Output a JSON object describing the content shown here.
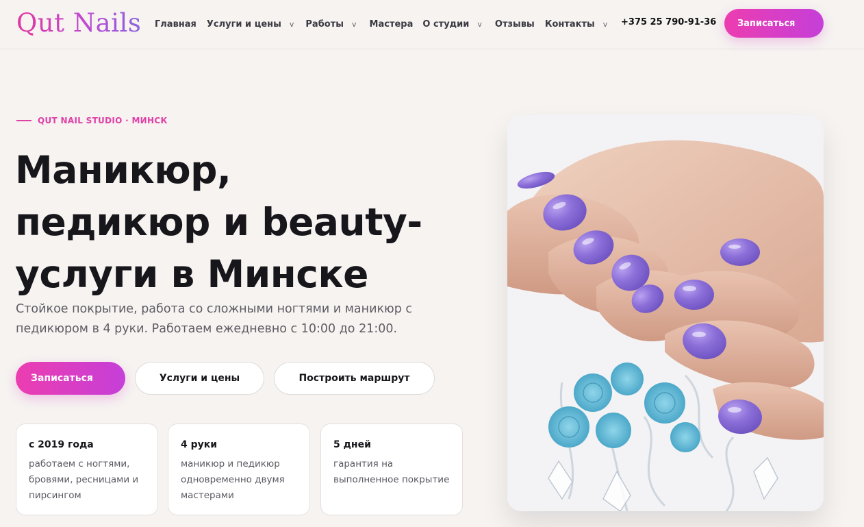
{
  "header": {
    "logo": "Qut Nails",
    "nav": [
      {
        "label": "Главная",
        "dropdown": false
      },
      {
        "label": "Услуги и цены",
        "dropdown": true
      },
      {
        "label": "Работы",
        "dropdown": true
      },
      {
        "label": "Мастера",
        "dropdown": false
      },
      {
        "label": "О студии",
        "dropdown": true
      },
      {
        "label": "Отзывы",
        "dropdown": false
      },
      {
        "label": "Контакты",
        "dropdown": true
      }
    ],
    "dropdown_glyph": "v",
    "phone": "+375 25 790-91-36",
    "cta": "Записаться"
  },
  "hero": {
    "eyebrow": "QUT NAIL STUDIO · МИНСК",
    "title_lines": [
      "Маникюр,",
      "педикюр и beauty-",
      "услуги в Минске"
    ],
    "subtitle": "Стойкое покрытие, работа со сложными ногтями и маникюр с педикюром в 4 руки. Работаем ежедневно с 10:00 до 21:00.",
    "buttons": {
      "primary": "Записаться",
      "services": "Услуги и цены",
      "route": "Построить маршрут"
    },
    "stats": [
      {
        "title": "с 2019 года",
        "text": "работаем с ногтями, бровями, ресницами и пирсингом"
      },
      {
        "title": "4 руки",
        "text": "маникюр и педикюр одновременно двумя мастерами"
      },
      {
        "title": "5 дней",
        "text": "гарантия на выполненное покрытие"
      }
    ]
  },
  "colors": {
    "accent": "#e03fa6",
    "accent_gradient_end": "#c53fd8",
    "background": "#f6f3f1",
    "nail_polish": "#8b6fd6",
    "flowers": "#5fb9d6"
  },
  "icons": {
    "dropdown": "chevron-down-icon",
    "photo": "manicure-hands-photo"
  }
}
